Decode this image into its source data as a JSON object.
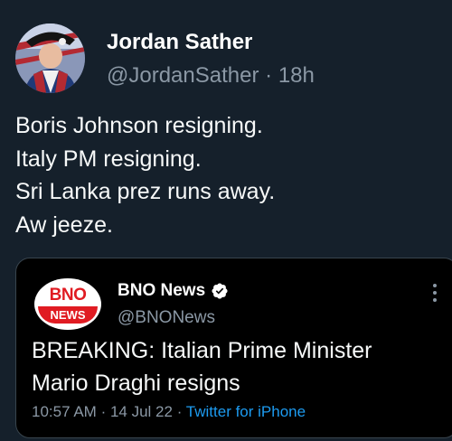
{
  "tweet": {
    "author_name": "Jordan Sather",
    "author_handle": "@JordanSather",
    "separator": "·",
    "time_ago": "18h",
    "body_lines": [
      "Boris Johnson resigning.",
      "Italy PM resigning.",
      "Sri Lanka prez runs away.",
      "Aw jeeze."
    ],
    "avatar_icon": "profile-photo-colonial-costume"
  },
  "quoted_tweet": {
    "logo_top": "BNO",
    "logo_bottom": "NEWS",
    "author_name": "BNO News",
    "author_handle": "@BNONews",
    "verified": true,
    "text_lines": [
      "BREAKING: Italian Prime Minister",
      "Mario Draghi resigns"
    ],
    "timestamp": "10:57 AM",
    "date": "14 Jul 22",
    "separator": "·",
    "source": "Twitter for iPhone"
  },
  "colors": {
    "background": "#15202b",
    "card_background": "#000000",
    "secondary_text": "#8b98a5",
    "link": "#1d9bf0",
    "verified": "#ffffff",
    "brand_red": "#e01b22"
  }
}
